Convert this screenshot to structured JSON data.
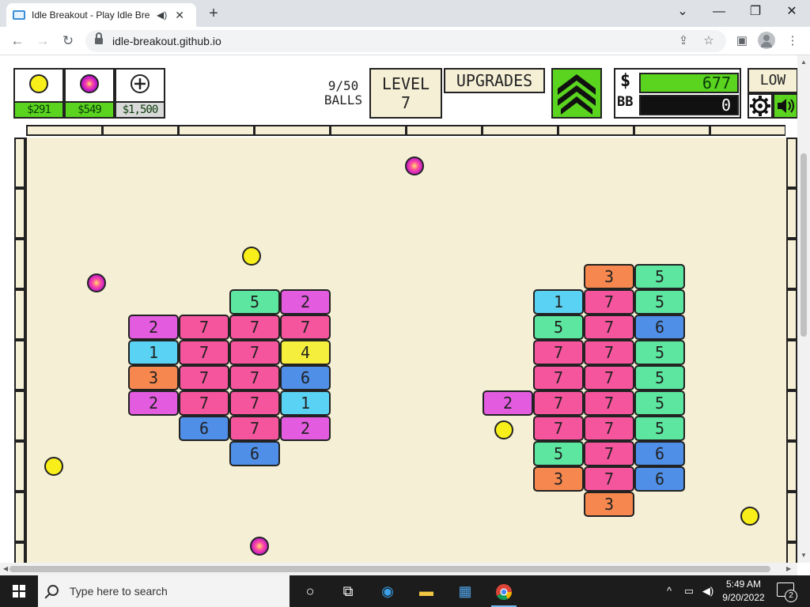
{
  "browser": {
    "tab_title": "Idle Breakout - Play Idle Breakout",
    "url": "idle-breakout.github.io",
    "icons": [
      "back-arrow-icon",
      "forward-arrow-icon",
      "reload-icon",
      "lock-icon",
      "share-icon",
      "star-icon",
      "side-panel-icon",
      "profile-icon",
      "menu-dots-icon"
    ]
  },
  "hud": {
    "buy_balls": [
      {
        "name": "basic-ball",
        "price": "$291",
        "color": "#f7ee1a"
      },
      {
        "name": "plasma-ball",
        "price": "$549",
        "color": "#e02ab8"
      },
      {
        "name": "add-ball",
        "price": "$1,500",
        "color": "#ffffff"
      }
    ],
    "ball_count": "9/50",
    "balls_label": "BALLS",
    "level_label": "LEVEL",
    "level_value": "7",
    "upgrades_label": "UPGRADES",
    "money_symbol": "$",
    "money_value": "677",
    "bb_symbol": "BB",
    "bb_value": "0",
    "quality_label": "LOW"
  },
  "bricks": [
    {
      "col": 4,
      "row": 5,
      "value": "5",
      "color": "#5ce6a0"
    },
    {
      "col": 5,
      "row": 5,
      "value": "2",
      "color": "#e35bdf"
    },
    {
      "col": 2,
      "row": 6,
      "value": "2",
      "color": "#e35bdf"
    },
    {
      "col": 3,
      "row": 6,
      "value": "7",
      "color": "#f5559c"
    },
    {
      "col": 4,
      "row": 6,
      "value": "7",
      "color": "#f5559c"
    },
    {
      "col": 5,
      "row": 6,
      "value": "7",
      "color": "#f5559c"
    },
    {
      "col": 2,
      "row": 7,
      "value": "1",
      "color": "#5ad2f3"
    },
    {
      "col": 3,
      "row": 7,
      "value": "7",
      "color": "#f5559c"
    },
    {
      "col": 4,
      "row": 7,
      "value": "7",
      "color": "#f5559c"
    },
    {
      "col": 5,
      "row": 7,
      "value": "4",
      "color": "#f6ee3c"
    },
    {
      "col": 2,
      "row": 8,
      "value": "3",
      "color": "#f5874f"
    },
    {
      "col": 3,
      "row": 8,
      "value": "7",
      "color": "#f5559c"
    },
    {
      "col": 4,
      "row": 8,
      "value": "7",
      "color": "#f5559c"
    },
    {
      "col": 5,
      "row": 8,
      "value": "6",
      "color": "#4f8fe8"
    },
    {
      "col": 2,
      "row": 9,
      "value": "2",
      "color": "#e35bdf"
    },
    {
      "col": 3,
      "row": 9,
      "value": "7",
      "color": "#f5559c"
    },
    {
      "col": 4,
      "row": 9,
      "value": "7",
      "color": "#f5559c"
    },
    {
      "col": 5,
      "row": 9,
      "value": "1",
      "color": "#5ad2f3"
    },
    {
      "col": 3,
      "row": 10,
      "value": "6",
      "color": "#4f8fe8"
    },
    {
      "col": 4,
      "row": 10,
      "value": "7",
      "color": "#f5559c"
    },
    {
      "col": 5,
      "row": 10,
      "value": "2",
      "color": "#e35bdf"
    },
    {
      "col": 4,
      "row": 11,
      "value": "6",
      "color": "#4f8fe8"
    },
    {
      "col": 11,
      "row": 4,
      "value": "3",
      "color": "#f5874f"
    },
    {
      "col": 12,
      "row": 4,
      "value": "5",
      "color": "#5ce6a0"
    },
    {
      "col": 10,
      "row": 5,
      "value": "1",
      "color": "#5ad2f3"
    },
    {
      "col": 11,
      "row": 5,
      "value": "7",
      "color": "#f5559c"
    },
    {
      "col": 12,
      "row": 5,
      "value": "5",
      "color": "#5ce6a0"
    },
    {
      "col": 10,
      "row": 6,
      "value": "5",
      "color": "#5ce6a0"
    },
    {
      "col": 11,
      "row": 6,
      "value": "7",
      "color": "#f5559c"
    },
    {
      "col": 12,
      "row": 6,
      "value": "6",
      "color": "#4f8fe8"
    },
    {
      "col": 10,
      "row": 7,
      "value": "7",
      "color": "#f5559c"
    },
    {
      "col": 11,
      "row": 7,
      "value": "7",
      "color": "#f5559c"
    },
    {
      "col": 12,
      "row": 7,
      "value": "5",
      "color": "#5ce6a0"
    },
    {
      "col": 10,
      "row": 8,
      "value": "7",
      "color": "#f5559c"
    },
    {
      "col": 11,
      "row": 8,
      "value": "7",
      "color": "#f5559c"
    },
    {
      "col": 12,
      "row": 8,
      "value": "5",
      "color": "#5ce6a0"
    },
    {
      "col": 9,
      "row": 9,
      "value": "2",
      "color": "#e35bdf"
    },
    {
      "col": 10,
      "row": 9,
      "value": "7",
      "color": "#f5559c"
    },
    {
      "col": 11,
      "row": 9,
      "value": "7",
      "color": "#f5559c"
    },
    {
      "col": 12,
      "row": 9,
      "value": "5",
      "color": "#5ce6a0"
    },
    {
      "col": 10,
      "row": 10,
      "value": "7",
      "color": "#f5559c"
    },
    {
      "col": 11,
      "row": 10,
      "value": "7",
      "color": "#f5559c"
    },
    {
      "col": 12,
      "row": 10,
      "value": "5",
      "color": "#5ce6a0"
    },
    {
      "col": 10,
      "row": 11,
      "value": "5",
      "color": "#5ce6a0"
    },
    {
      "col": 11,
      "row": 11,
      "value": "7",
      "color": "#f5559c"
    },
    {
      "col": 12,
      "row": 11,
      "value": "6",
      "color": "#4f8fe8"
    },
    {
      "col": 10,
      "row": 12,
      "value": "3",
      "color": "#f5874f"
    },
    {
      "col": 11,
      "row": 12,
      "value": "7",
      "color": "#f5559c"
    },
    {
      "col": 12,
      "row": 12,
      "value": "6",
      "color": "#4f8fe8"
    },
    {
      "col": 11,
      "row": 13,
      "value": "3",
      "color": "#f5874f"
    }
  ],
  "balls": [
    {
      "type": "pink",
      "id": "p1"
    },
    {
      "type": "yellow",
      "id": "y1"
    },
    {
      "type": "pink",
      "id": "p2"
    },
    {
      "type": "yellow",
      "id": "y2"
    },
    {
      "type": "yellow",
      "id": "y3"
    },
    {
      "type": "yellow",
      "id": "y4"
    },
    {
      "type": "pink",
      "id": "p3"
    }
  ],
  "taskbar": {
    "search_placeholder": "Type here to search",
    "time": "5:49 AM",
    "date": "9/20/2022",
    "notifications": "2"
  }
}
